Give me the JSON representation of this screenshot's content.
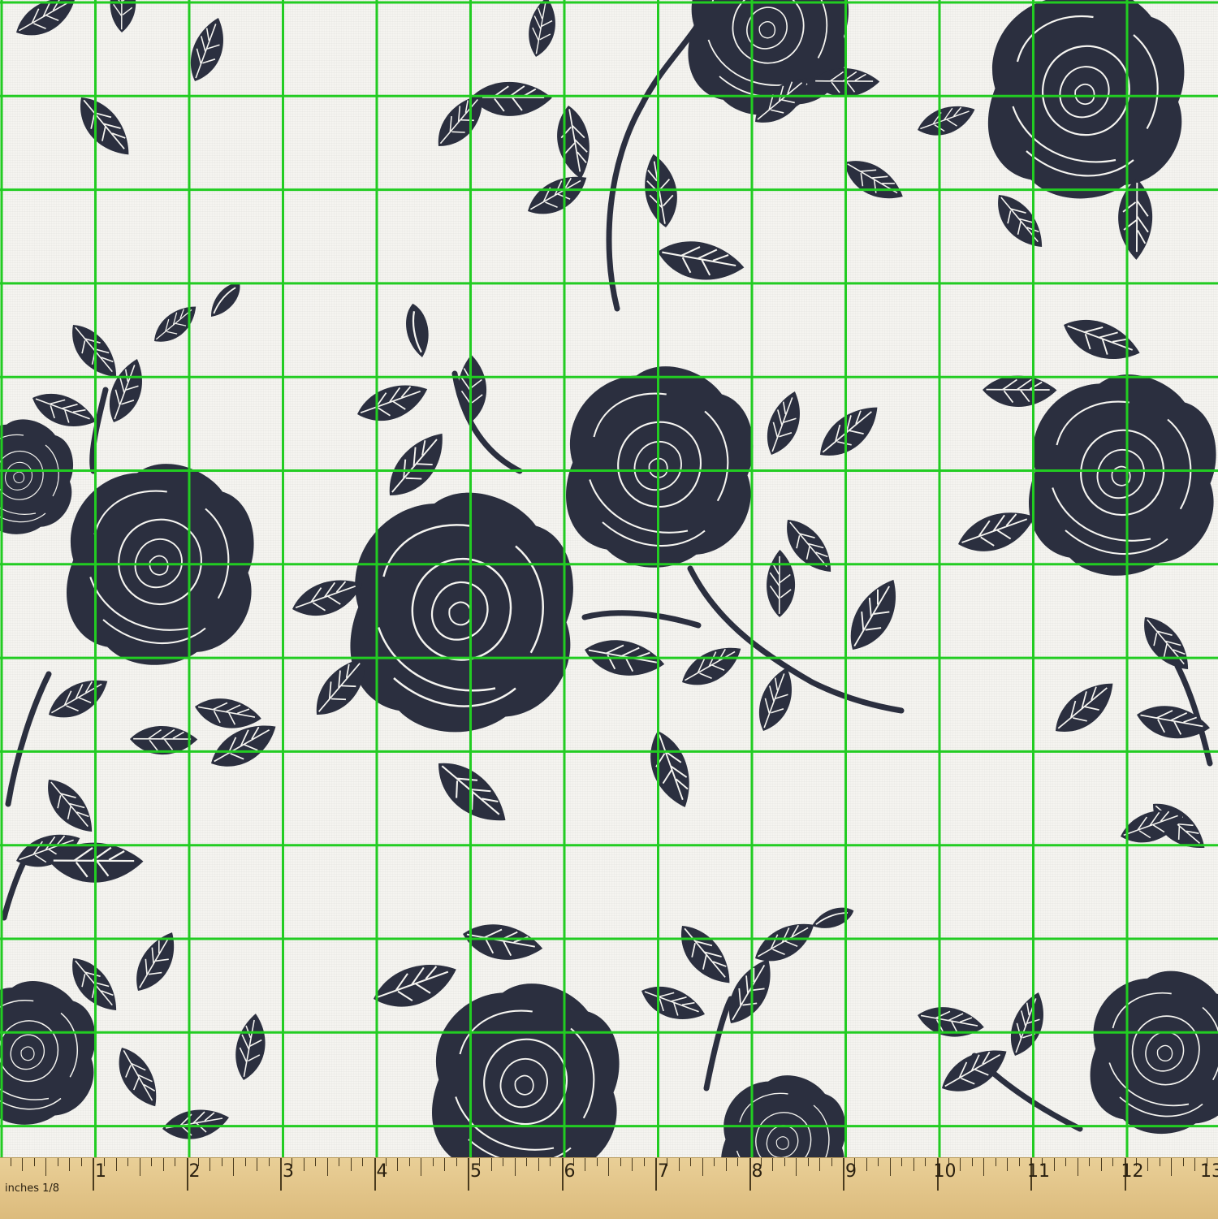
{
  "pattern": {
    "description_colors": {
      "background": "#f5f4f0",
      "ink": "#2b2f3f",
      "grid": "#2ad12a",
      "ruler": "#e2c68a"
    }
  },
  "ruler": {
    "unit_label": "inches 1/8",
    "numbers": [
      "1",
      "2",
      "3",
      "4",
      "5",
      "6",
      "7",
      "8",
      "9",
      "10",
      "11",
      "12",
      "13"
    ]
  }
}
